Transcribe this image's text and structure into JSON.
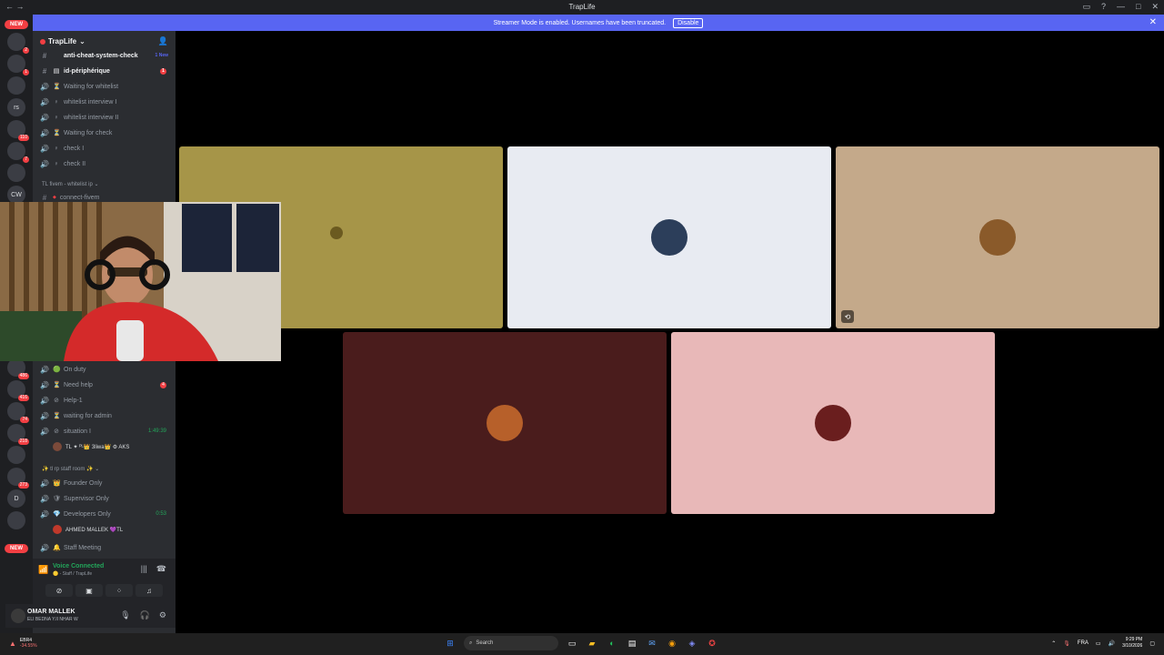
{
  "window": {
    "title": "TrapLife"
  },
  "streamer_banner": {
    "text": "Streamer Mode is enabled. Usernames have been truncated.",
    "button": "Disable"
  },
  "guild_new": "NEW",
  "guild_new_bottom": "NEW",
  "guilds": [
    {
      "label": "",
      "badge": "2"
    },
    {
      "label": "",
      "badge": "1"
    },
    {
      "label": "",
      "badge": ""
    },
    {
      "label": "rs",
      "badge": ""
    },
    {
      "label": "",
      "badge": "110"
    },
    {
      "label": "",
      "badge": "7"
    },
    {
      "label": "",
      "badge": ""
    },
    {
      "label": "CW",
      "badge": ""
    }
  ],
  "guilds_lower": [
    {
      "label": "",
      "badge": "486"
    },
    {
      "label": "",
      "badge": "416"
    },
    {
      "label": "",
      "badge": "74"
    },
    {
      "label": "",
      "badge": "218"
    },
    {
      "label": "",
      "badge": ""
    },
    {
      "label": "",
      "badge": "273"
    },
    {
      "label": "D",
      "badge": ""
    },
    {
      "label": "",
      "badge": ""
    }
  ],
  "server": {
    "name": "TrapLife"
  },
  "channels_top": [
    {
      "name": "anti-cheat-system-check",
      "type": "text",
      "extra": "1 New",
      "bright": true
    },
    {
      "name": "id-périphérique",
      "type": "text",
      "badge": "1",
      "bright": true
    },
    {
      "name": "Waiting for whitelist",
      "type": "voice"
    },
    {
      "name": "whitelist interview I",
      "type": "voice"
    },
    {
      "name": "whitelist interview II",
      "type": "voice"
    },
    {
      "name": "Waiting for check",
      "type": "voice"
    },
    {
      "name": "check I",
      "type": "voice"
    },
    {
      "name": "check II",
      "type": "voice"
    }
  ],
  "category_fivem": "TL fivem - whitelist ip",
  "channel_connect": "connect-fivem",
  "channels_bottom": [
    {
      "name": "On duty",
      "type": "voice"
    },
    {
      "name": "Need help",
      "type": "voice",
      "badge": "4"
    },
    {
      "name": "Help-1",
      "type": "voice"
    },
    {
      "name": "waiting for admin",
      "type": "voice"
    },
    {
      "name": "situation I",
      "type": "voice",
      "timer": "1:49:39"
    }
  ],
  "situation_member": "TL ✦ ᴾᴸ👑 3liwa👑 ⚙ AKS",
  "category_staff": "tl rp staff room",
  "staff_channels": [
    {
      "name": "Founder Only"
    },
    {
      "name": "Supervisor Only"
    },
    {
      "name": "Developers Only",
      "timer": "0:53"
    }
  ],
  "dev_member": "AHMED MALLEK 💜TL",
  "staff_meeting": "Staff Meeting",
  "voice": {
    "status": "Voice Connected",
    "location": "🟡 - Staff / TrapLife"
  },
  "user": {
    "name": "OMAR MALLEK",
    "status": "ELI BEDNA Y.II NHAR W"
  },
  "tiles": [
    {
      "bg": "#a69548"
    },
    {
      "bg": "#e8ebf2"
    },
    {
      "bg": "#c4a98a"
    },
    {
      "bg": "#4a1c1c"
    },
    {
      "bg": "#e8b8b8"
    }
  ],
  "taskbar": {
    "weather_value": "EUR/USD",
    "weather_change": "-34.55%",
    "weather_code": "EBR4",
    "search": "Search",
    "lang": "FRA",
    "time": "9:29 PM",
    "date": "3/10/2026"
  }
}
